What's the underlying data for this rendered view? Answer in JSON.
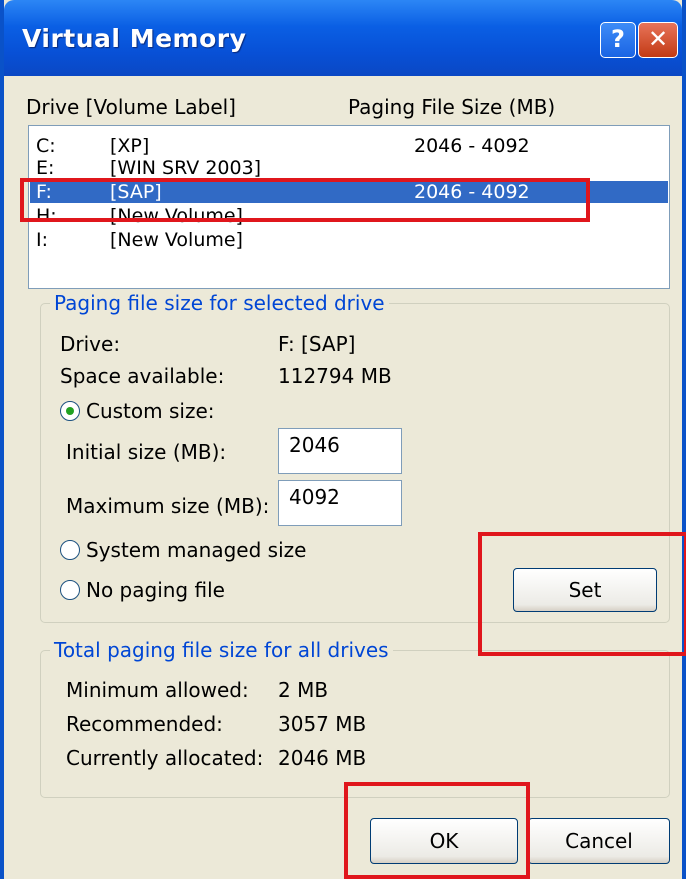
{
  "window": {
    "title": "Virtual Memory"
  },
  "titlebar": {
    "help_glyph": "?",
    "close_glyph": "✕"
  },
  "list": {
    "header_drive": "Drive  [Volume Label]",
    "header_size": "Paging File Size (MB)",
    "rows": [
      {
        "drive": "C:",
        "label": "[XP]",
        "size": "2046 - 4092"
      },
      {
        "drive": "E:",
        "label": "[WIN SRV 2003]",
        "size": ""
      },
      {
        "drive": "F:",
        "label": "[SAP]",
        "size": "2046 - 4092"
      },
      {
        "drive": "H:",
        "label": "[New Volume]",
        "size": ""
      },
      {
        "drive": "I:",
        "label": "[New Volume]",
        "size": ""
      }
    ],
    "selected_index": 2
  },
  "selected_drive": {
    "group_title": "Paging file size for selected drive",
    "drive_label": "Drive:",
    "drive_value": "F:  [SAP]",
    "space_label": "Space available:",
    "space_value": "112794 MB",
    "custom_label": "Custom size:",
    "initial_label": "Initial size (MB):",
    "initial_value": "2046",
    "maximum_label": "Maximum size (MB):",
    "maximum_value": "4092",
    "system_managed_label": "System managed size",
    "no_paging_label": "No paging file",
    "selected_option": "custom",
    "set_label": "Set"
  },
  "totals": {
    "group_title": "Total paging file size for all drives",
    "min_label": "Minimum allowed:",
    "min_value": "2 MB",
    "rec_label": "Recommended:",
    "rec_value": "3057 MB",
    "cur_label": "Currently allocated:",
    "cur_value": "2046 MB"
  },
  "buttons": {
    "ok_label": "OK",
    "cancel_label": "Cancel"
  },
  "colors": {
    "titlebar": "#0A5FE4",
    "selection": "#316AC5",
    "group_title": "#0046D5",
    "highlight": "#E0161C"
  }
}
